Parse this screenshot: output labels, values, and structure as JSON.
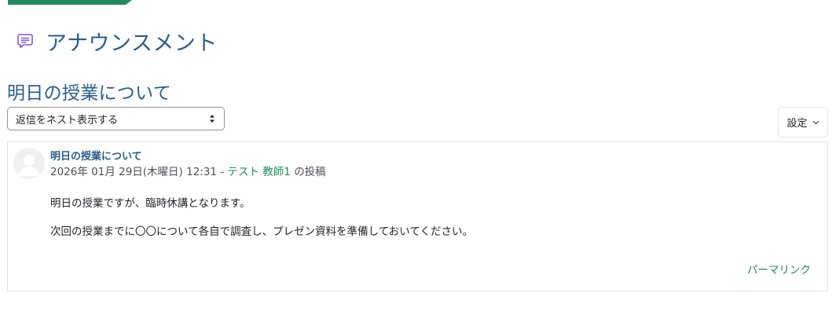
{
  "header": {
    "title": "アナウンスメント",
    "icon": "forum-icon"
  },
  "discussion": {
    "title": "明日の授業について"
  },
  "controls": {
    "display_mode": "返信をネスト表示する",
    "settings_label": "設定"
  },
  "post": {
    "subject": "明日の授業について",
    "date": "2026年 01月 29日(木曜日) 12:31",
    "separator": "-",
    "author": "テスト 教師1",
    "author_suffix": "の投稿",
    "body": [
      "明日の授業ですが、臨時休講となります。",
      "次回の授業までに〇〇について各自で調査し、プレゼン資料を準備しておいてください。"
    ],
    "permalink_label": "パーマリンク"
  },
  "colors": {
    "accent_green": "#1f8a5b",
    "title_blue": "#2b5d8d",
    "icon_purple": "#7f56d9"
  }
}
